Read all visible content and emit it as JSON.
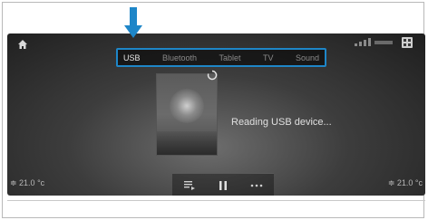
{
  "tabs": [
    {
      "label": "USB",
      "active": true
    },
    {
      "label": "Bluetooth",
      "active": false
    },
    {
      "label": "Tablet",
      "active": false
    },
    {
      "label": "TV",
      "active": false
    },
    {
      "label": "Sound",
      "active": false
    }
  ],
  "status": {
    "message": "Reading USB device..."
  },
  "climate": {
    "left_temp": "21.0",
    "right_temp": "21.0"
  },
  "colors": {
    "accent": "#1e86c8",
    "screen_bg": "#2e2e2e",
    "text": "#e0e0e0"
  },
  "icons": {
    "home": "home-icon",
    "signal": "signal-status-icon",
    "grid": "grid-menu-icon",
    "arrow": "pointer-arrow-icon",
    "loading": "loading-spinner-icon",
    "playlist": "playlist-icon",
    "pause": "pause-icon",
    "more": "more-options-icon"
  }
}
